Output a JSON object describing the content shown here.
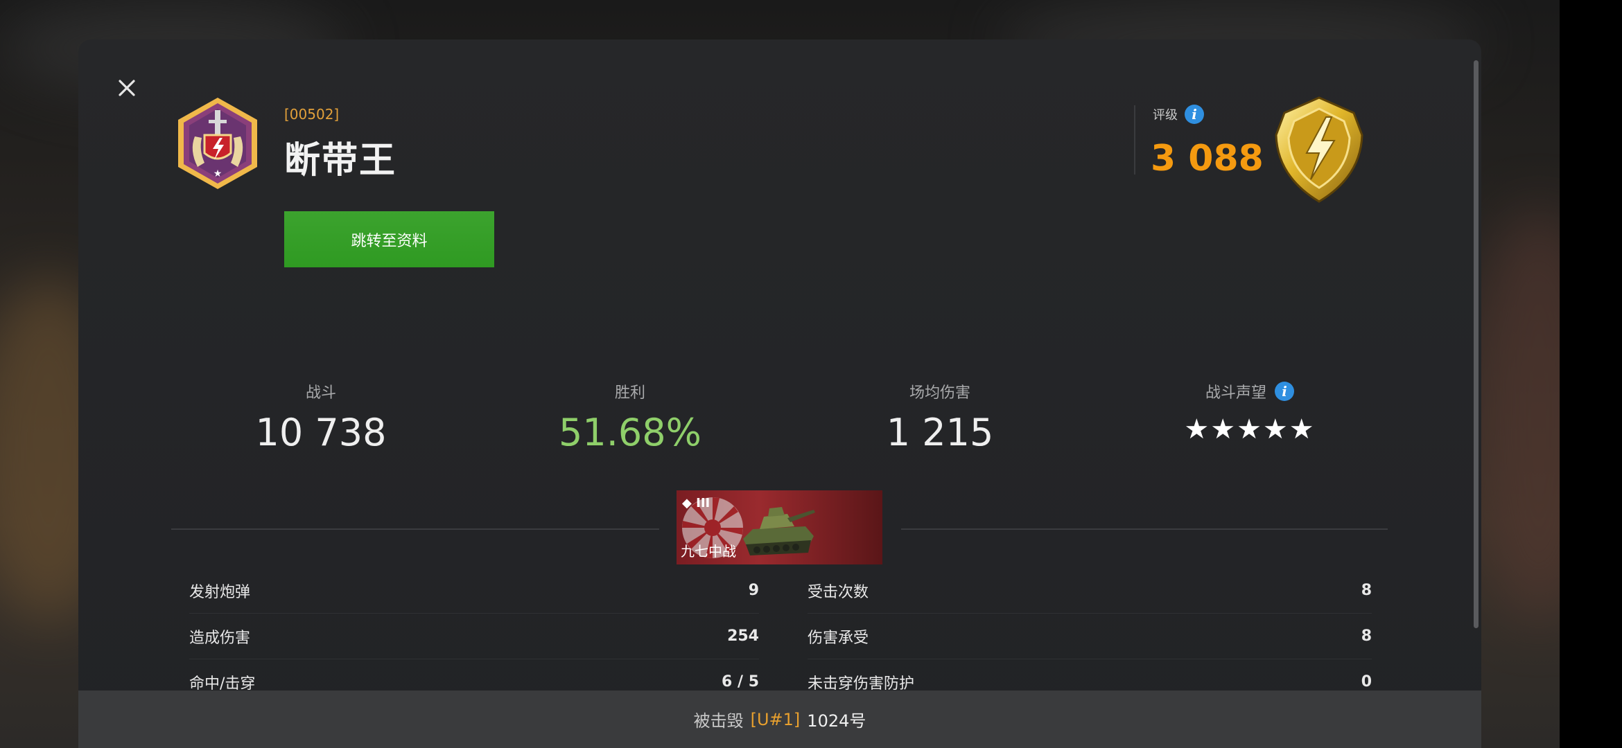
{
  "player": {
    "clan_tag": "[00502]",
    "name": "断带王",
    "profile_button": "跳转至资料"
  },
  "rating": {
    "label": "评级",
    "value": "3 088"
  },
  "stats": [
    {
      "label": "战斗",
      "value": "10 738"
    },
    {
      "label": "胜利",
      "value": "51.68%"
    },
    {
      "label": "场均伤害",
      "value": "1 215"
    },
    {
      "label": "战斗声望",
      "stars": "★★★★★"
    }
  ],
  "tank": {
    "tier": "III",
    "name": "九七中战"
  },
  "details": {
    "left": [
      {
        "label": "发射炮弹",
        "value": "9"
      },
      {
        "label": "造成伤害",
        "value": "254"
      },
      {
        "label": "命中/击穿",
        "value": "6 / 5"
      }
    ],
    "right": [
      {
        "label": "受击次数",
        "value": "8"
      },
      {
        "label": "伤害承受",
        "value": "8"
      },
      {
        "label": "未击穿伤害防护",
        "value": "0"
      }
    ]
  },
  "footer": {
    "prefix": "被击毁",
    "tag": "[U#1]",
    "name": "1024号"
  },
  "colors": {
    "accent_orange": "#f59a10",
    "win_green": "#8fcf6a",
    "button_green": "#34a028",
    "info_blue": "#2f8fe0"
  }
}
